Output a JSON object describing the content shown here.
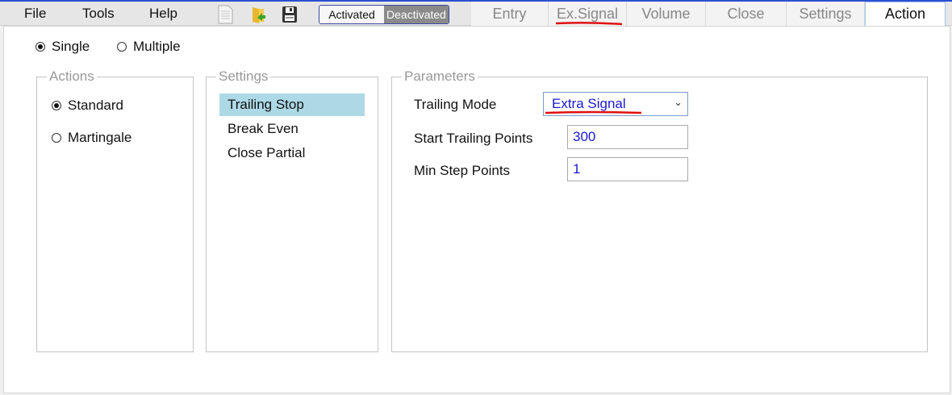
{
  "menu": {
    "file": "File",
    "tools": "Tools",
    "help": "Help"
  },
  "toolbar": {
    "icons": [
      "new-file-icon",
      "open-folder-icon",
      "save-icon"
    ],
    "activated": "Activated",
    "deactivated": "Deactivated",
    "state": "Deactivated"
  },
  "tabs": [
    {
      "label": "Entry"
    },
    {
      "label": "Ex.Signal"
    },
    {
      "label": "Volume"
    },
    {
      "label": "Close"
    },
    {
      "label": "Settings"
    },
    {
      "label": "Action",
      "active": true
    }
  ],
  "mode": {
    "single": "Single",
    "multiple": "Multiple",
    "selected": "Single"
  },
  "actions": {
    "title": "Actions",
    "options": [
      "Standard",
      "Martingale"
    ],
    "selected": "Standard"
  },
  "settings": {
    "title": "Settings",
    "items": [
      "Trailing Stop",
      "Break Even",
      "Close Partial"
    ],
    "selected": "Trailing Stop"
  },
  "parameters": {
    "title": "Parameters",
    "trailing_mode_label": "Trailing Mode",
    "trailing_mode_value": "Extra Signal",
    "start_label": "Start Trailing Points",
    "start_value": "300",
    "min_step_label": "Min Step Points",
    "min_step_value": "1"
  },
  "colors": {
    "accent": "#2b4fd0",
    "selection": "#add8e6",
    "value_text": "#1a1ad0",
    "annotation": "#e01010"
  }
}
